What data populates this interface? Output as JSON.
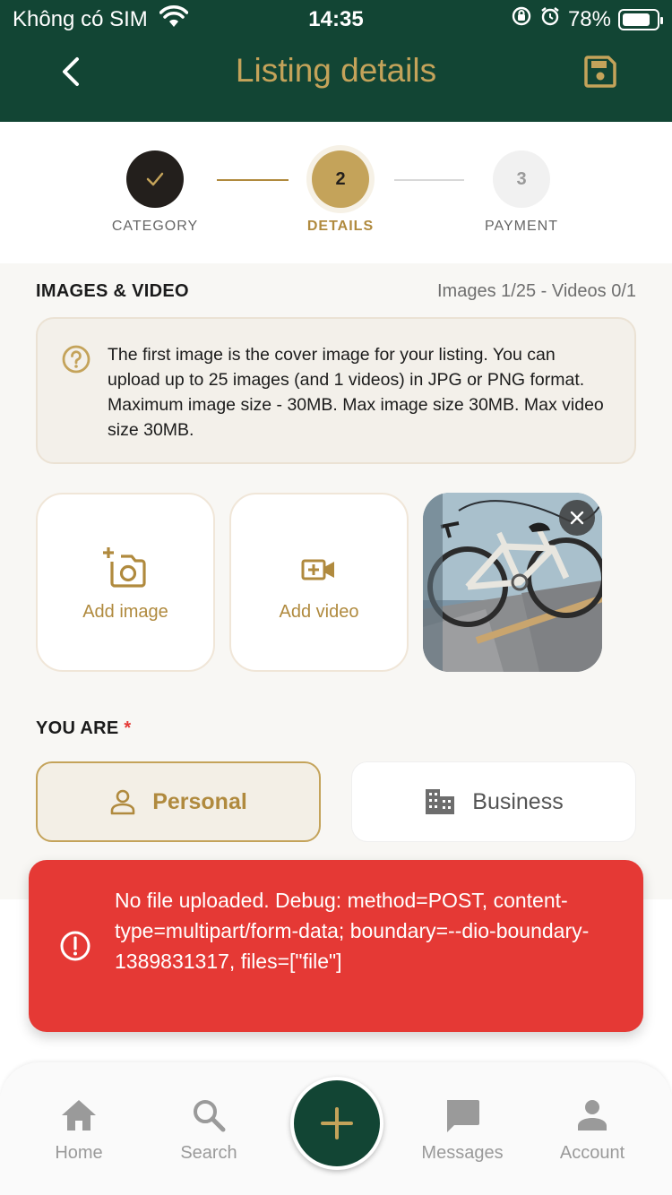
{
  "status_bar": {
    "carrier": "Không có SIM",
    "time": "14:35",
    "battery": "78%"
  },
  "header": {
    "title": "Listing details"
  },
  "stepper": {
    "steps": [
      {
        "label": "CATEGORY",
        "number": "",
        "state": "done"
      },
      {
        "label": "DETAILS",
        "number": "2",
        "state": "active"
      },
      {
        "label": "PAYMENT",
        "number": "3",
        "state": "pending"
      }
    ]
  },
  "media": {
    "section_title": "IMAGES & VIDEO",
    "counter": "Images 1/25 - Videos 0/1",
    "info": "The first image is the cover image for your listing. You can upload up to 25 images (and 1 videos) in JPG or PNG format. Maximum image size - 30MB. Max image size 30MB. Max video size 30MB.",
    "add_image_label": "Add image",
    "add_video_label": "Add video"
  },
  "seller_type": {
    "section_title": "YOU ARE",
    "required_mark": "*",
    "options": [
      "Personal",
      "Business"
    ],
    "selected": "Personal"
  },
  "toast": {
    "message": "No file uploaded. Debug: method=POST, content-type=multipart/form-data; boundary=--dio-boundary-1389831317, files=[\"file\"]"
  },
  "bottom_nav": {
    "items": [
      "Home",
      "Search",
      "Messages",
      "Account"
    ]
  },
  "colors": {
    "header_bg": "#124534",
    "accent_gold": "#c4a35a",
    "error_red": "#e53935",
    "content_bg": "#f8f7f4"
  },
  "icons": [
    "back-icon",
    "save-icon",
    "check-icon",
    "help-icon",
    "add-photo-icon",
    "add-video-icon",
    "close-icon",
    "person-icon",
    "building-icon",
    "error-icon",
    "home-icon",
    "search-icon",
    "plus-icon",
    "chat-icon",
    "account-icon"
  ]
}
